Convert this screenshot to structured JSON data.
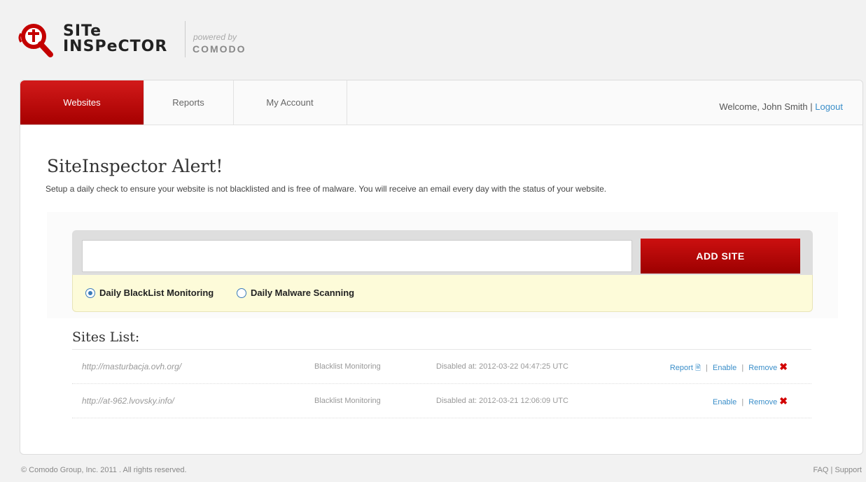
{
  "header": {
    "logo_line1": "SITe",
    "logo_line2": "INSPeCTOR",
    "powered_by": "powered by",
    "brand": "COMODO"
  },
  "nav": {
    "tabs": [
      {
        "label": "Websites"
      },
      {
        "label": "Reports"
      },
      {
        "label": "My Account"
      }
    ],
    "welcome_text": "Welcome, John Smith",
    "separator": "|",
    "logout_label": "Logout"
  },
  "alert": {
    "title": "SiteInspector Alert!",
    "description": "Setup a daily check to ensure your website is not blacklisted and is free of malware. You will receive an email every day with the status of your website."
  },
  "form": {
    "site_input_value": "",
    "add_button_label": "ADD SITE",
    "options": [
      {
        "label": "Daily BlackList Monitoring",
        "selected": true
      },
      {
        "label": "Daily Malware Scanning",
        "selected": false
      }
    ]
  },
  "sites": {
    "title": "Sites List:",
    "rows": [
      {
        "url": "http://masturbacja.ovh.org/",
        "monitor": "Blacklist Monitoring",
        "status": "Disabled at: 2012-03-22 04:47:25 UTC",
        "report_label": "Report",
        "enable_label": "Enable",
        "remove_label": "Remove"
      },
      {
        "url": "http://at-962.lvovsky.info/",
        "monitor": "Blacklist Monitoring",
        "status": "Disabled at: 2012-03-21 12:06:09 UTC",
        "enable_label": "Enable",
        "remove_label": "Remove"
      }
    ]
  },
  "footer": {
    "copyright": "© Comodo Group, Inc. 2011 . All rights reserved.",
    "links": "FAQ | Support"
  },
  "colors": {
    "accent_red": "#b80808",
    "link_blue": "#3a8ec9",
    "options_bg": "#fdfbd9"
  }
}
